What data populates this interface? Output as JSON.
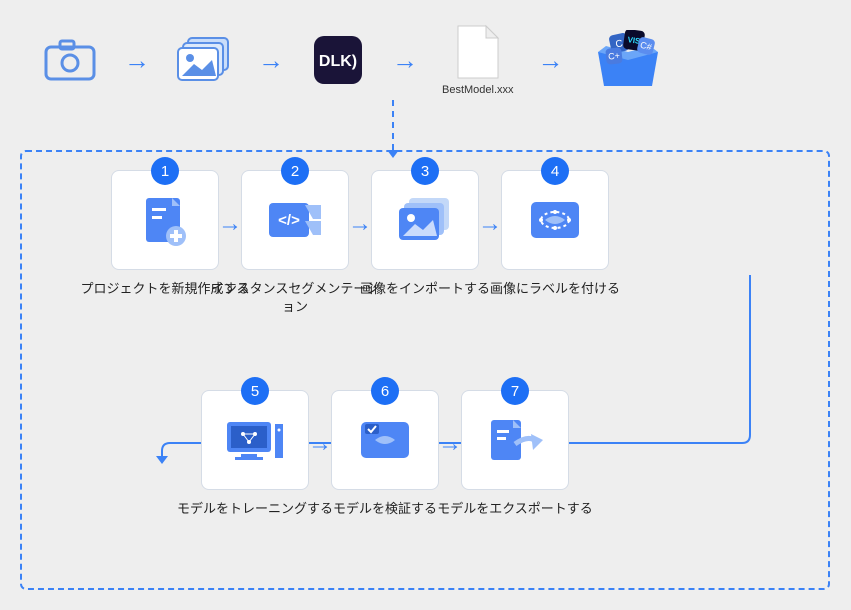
{
  "top_flow": {
    "file_label": "BestModel.xxx"
  },
  "steps": [
    {
      "num": "1",
      "label": "プロジェクトを新規作成する"
    },
    {
      "num": "2",
      "label": "インスタンスセグメンテーション"
    },
    {
      "num": "3",
      "label": "画像をインポートする"
    },
    {
      "num": "4",
      "label": "画像にラベルを付ける"
    },
    {
      "num": "5",
      "label": "モデルをトレーニングする"
    },
    {
      "num": "6",
      "label": "モデルを検証する"
    },
    {
      "num": "7",
      "label": "モデルをエクスポートする"
    }
  ]
}
